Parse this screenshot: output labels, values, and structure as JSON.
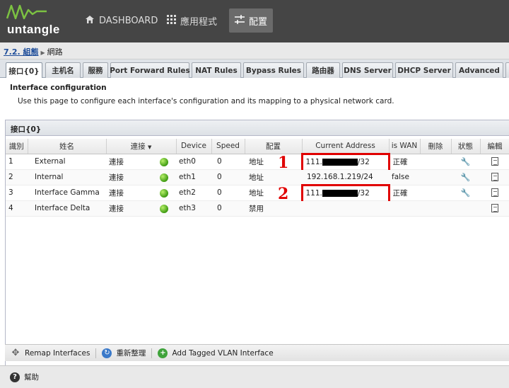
{
  "brand": {
    "name": "untangle"
  },
  "nav": [
    {
      "label": "DASHBOARD",
      "icon": "home-icon"
    },
    {
      "label": "應用程式",
      "icon": "grid-icon"
    },
    {
      "label": "配置",
      "icon": "sliders-icon"
    }
  ],
  "breadcrumb": {
    "link": "7.2. 組態",
    "current": "網路"
  },
  "tabs": [
    "接口{0}",
    "主机名",
    "服務",
    "Port Forward Rules",
    "NAT Rules",
    "Bypass Rules",
    "路由器",
    "DNS Server",
    "DHCP Server",
    "Advanced"
  ],
  "config": {
    "title": "Interface configuration",
    "description": "Use this page to configure each interface's configuration and its mapping to a physical network card."
  },
  "panel": {
    "title": "接口{0}"
  },
  "columns": [
    "識別",
    "姓名",
    "連接",
    "Device",
    "Speed",
    "配置",
    "Current Address",
    "is WAN",
    "刪除",
    "狀態",
    "編輯"
  ],
  "rows": [
    {
      "id": "1",
      "name": "External",
      "connected": "連接",
      "device": "eth0",
      "speed": "0",
      "config": "地址",
      "addr_prefix": "111.",
      "addr_suffix": "/32",
      "is_wan": "正確"
    },
    {
      "id": "2",
      "name": "Internal",
      "connected": "連接",
      "device": "eth1",
      "speed": "0",
      "config": "地址",
      "addr_full": "192.168.1.219/24",
      "is_wan": "false"
    },
    {
      "id": "3",
      "name": "Interface Gamma",
      "connected": "連接",
      "device": "eth2",
      "speed": "0",
      "config": "地址",
      "addr_prefix": "111.",
      "addr_suffix": "/32",
      "is_wan": "正確"
    },
    {
      "id": "4",
      "name": "Interface Delta",
      "connected": "連接",
      "device": "eth3",
      "speed": "0",
      "config": "禁用",
      "addr_full": "",
      "is_wan": ""
    }
  ],
  "markers": [
    "1",
    "2"
  ],
  "toolbar": {
    "remap": "Remap Interfaces",
    "refresh": "重新整理",
    "add_vlan": "Add Tagged VLAN Interface"
  },
  "footer": {
    "help": "幫助"
  },
  "colors": {
    "header_bg": "#454545",
    "highlight": "#e00000",
    "link": "#1f4e9a",
    "led": "#3e9a12"
  }
}
